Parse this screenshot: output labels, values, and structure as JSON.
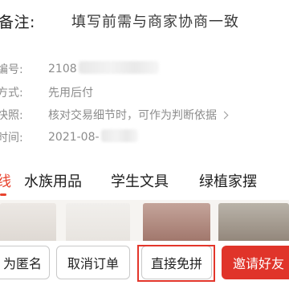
{
  "remark": {
    "label": "备注:",
    "value": "填写前需与商家协商一致"
  },
  "order_info": [
    {
      "key": "编号:",
      "value": "2108",
      "blurred": true
    },
    {
      "key": "方式:",
      "value": "先用后付"
    },
    {
      "key": "快照:",
      "value": "核对交易细节时，可作为判断依据",
      "chevron": true
    },
    {
      "key": "时间:",
      "value": "2021-08-",
      "blurred": true
    }
  ],
  "category_tabs": [
    {
      "label": "线",
      "active": true
    },
    {
      "label": "水族用品"
    },
    {
      "label": "学生文具"
    },
    {
      "label": "绿植家摆"
    }
  ],
  "actions": {
    "anonymous": "为匿名",
    "cancel": "取消订单",
    "direct": "直接免拼",
    "invite": "邀请好友"
  },
  "colors": {
    "accent": "#e0342a",
    "highlight_border": "#e3362b",
    "muted_text": "#8c8c8c"
  }
}
